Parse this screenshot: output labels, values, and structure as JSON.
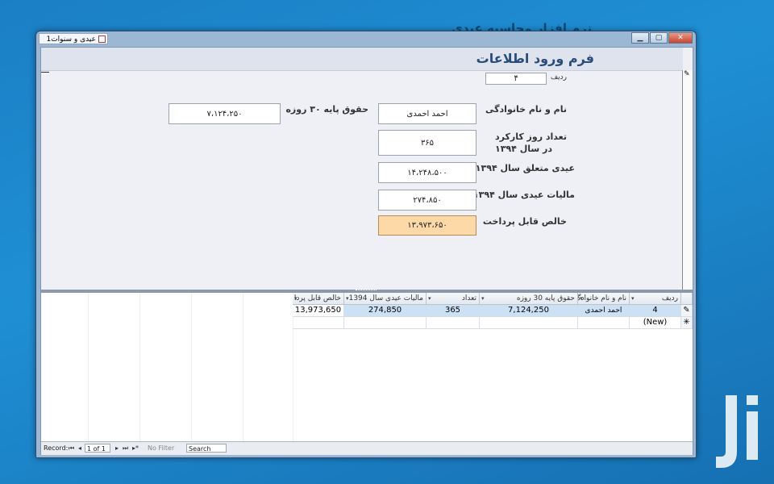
{
  "desktop": {
    "title": "نرم افزار محاسبه عیدی"
  },
  "window": {
    "tab_title": "عیدی و سنوات1",
    "controls": {
      "minimize": "▁",
      "maximize": "▢",
      "close": "✕"
    }
  },
  "form": {
    "heading": "فرم ورود اطلاعات",
    "record_label": "ردیف",
    "record_value": "۴",
    "fields": {
      "name_label": "نام و نام خانوادگی",
      "name_value": "احمد احمدی",
      "days_label_line1": "تعداد روز کارکرد",
      "days_label_line2": "در سال ۱۳۹۴",
      "days_value": "۳۶۵",
      "bonus_label": "عیدی متعلق سال ۱۳۹۴",
      "bonus_value": "۱۴،۲۴۸،۵۰۰",
      "tax_label": "مالیات عیدی سال ۱۳۹۴",
      "tax_value": "۲۷۴،۸۵۰",
      "net_label": "خالص قابل پرداخت",
      "net_value": "۱۳،۹۷۳،۶۵۰",
      "base_salary_label": "حقوق پایه ۳۰ روزه",
      "base_salary_value": "۷،۱۲۴،۲۵۰"
    }
  },
  "datasheet": {
    "columns": {
      "row": "ردیف",
      "name": "نام و نام خانوادگ",
      "base": "حقوق پایه 30 روزه",
      "count": "تعداد",
      "tax": "مالیات عیدی سال 1394",
      "net": "خالص قابل پردا"
    },
    "dropdown_glyph": "▾",
    "row1": {
      "row": "4",
      "name": "احمد احمدی",
      "base": "7,124,250",
      "count": "365",
      "tax": "274,850",
      "net": "13,973,650",
      "selector": "✎"
    },
    "new_row": {
      "label": "(New)",
      "selector": "✳"
    }
  },
  "statusbar": {
    "record_label": "Record:",
    "first": "⏮",
    "prev": "◂",
    "position": "1 of 1",
    "next": "▸",
    "last": "⏭",
    "new": "▸*",
    "filter": "No Filter",
    "search_placeholder": "Search"
  },
  "colors": {
    "desktop": "#1f8fd4",
    "highlight_field": "#fdd9a8",
    "selected_row": "#cde1f5"
  }
}
